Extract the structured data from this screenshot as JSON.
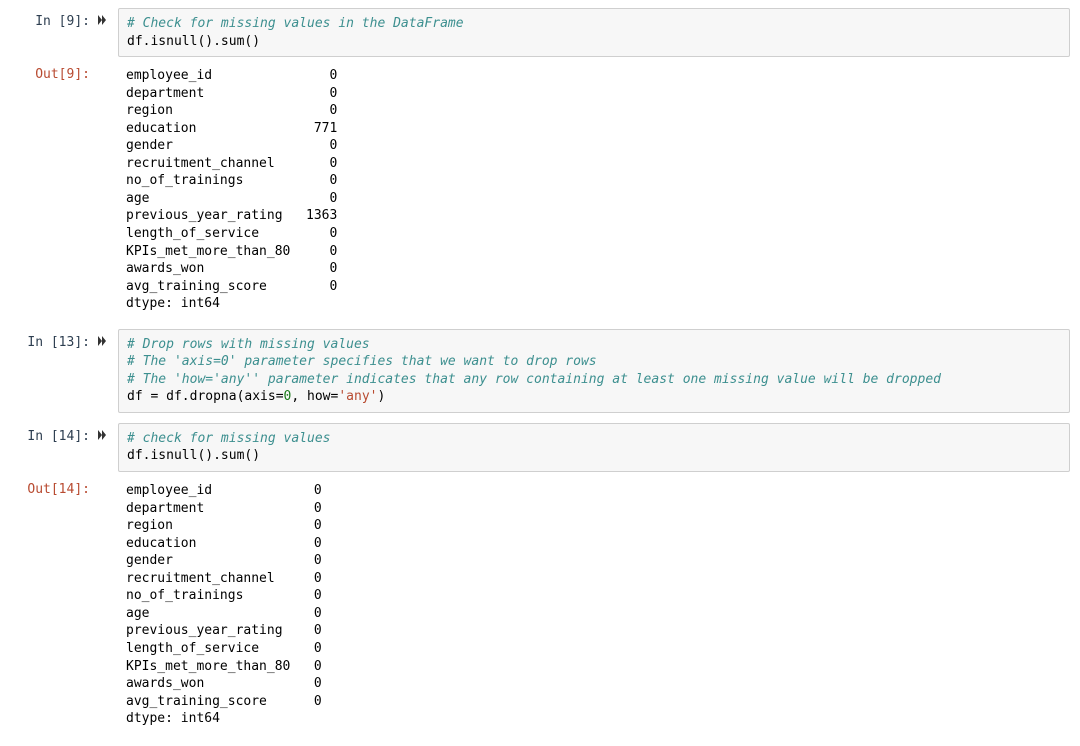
{
  "cells": {
    "c9": {
      "prompt_in": "In [9]:",
      "prompt_out": "Out[9]:",
      "code": {
        "comment1": "# Check for missing values in the DataFrame",
        "line2": "df.isnull().sum()"
      },
      "output": "employee_id               0\ndepartment                0\nregion                    0\neducation               771\ngender                    0\nrecruitment_channel       0\nno_of_trainings           0\nage                       0\nprevious_year_rating   1363\nlength_of_service         0\nKPIs_met_more_than_80     0\nawards_won                0\navg_training_score        0\ndtype: int64"
    },
    "c13": {
      "prompt_in": "In [13]:",
      "code": {
        "comment1": "# Drop rows with missing values",
        "comment2": "# The 'axis=0' parameter specifies that we want to drop rows",
        "comment3": "# The 'how='any'' parameter indicates that any row containing at least one missing value will be dropped",
        "line4_a": "df = df.dropna(axis=",
        "line4_num": "0",
        "line4_b": ", how=",
        "line4_str": "'any'",
        "line4_c": ")"
      }
    },
    "c14": {
      "prompt_in": "In [14]:",
      "prompt_out": "Out[14]:",
      "code": {
        "comment1": "# check for missing values",
        "line2": "df.isnull().sum()"
      },
      "output": "employee_id             0\ndepartment              0\nregion                  0\neducation               0\ngender                  0\nrecruitment_channel     0\nno_of_trainings         0\nage                     0\nprevious_year_rating    0\nlength_of_service       0\nKPIs_met_more_than_80   0\nawards_won              0\navg_training_score      0\ndtype: int64"
    }
  }
}
